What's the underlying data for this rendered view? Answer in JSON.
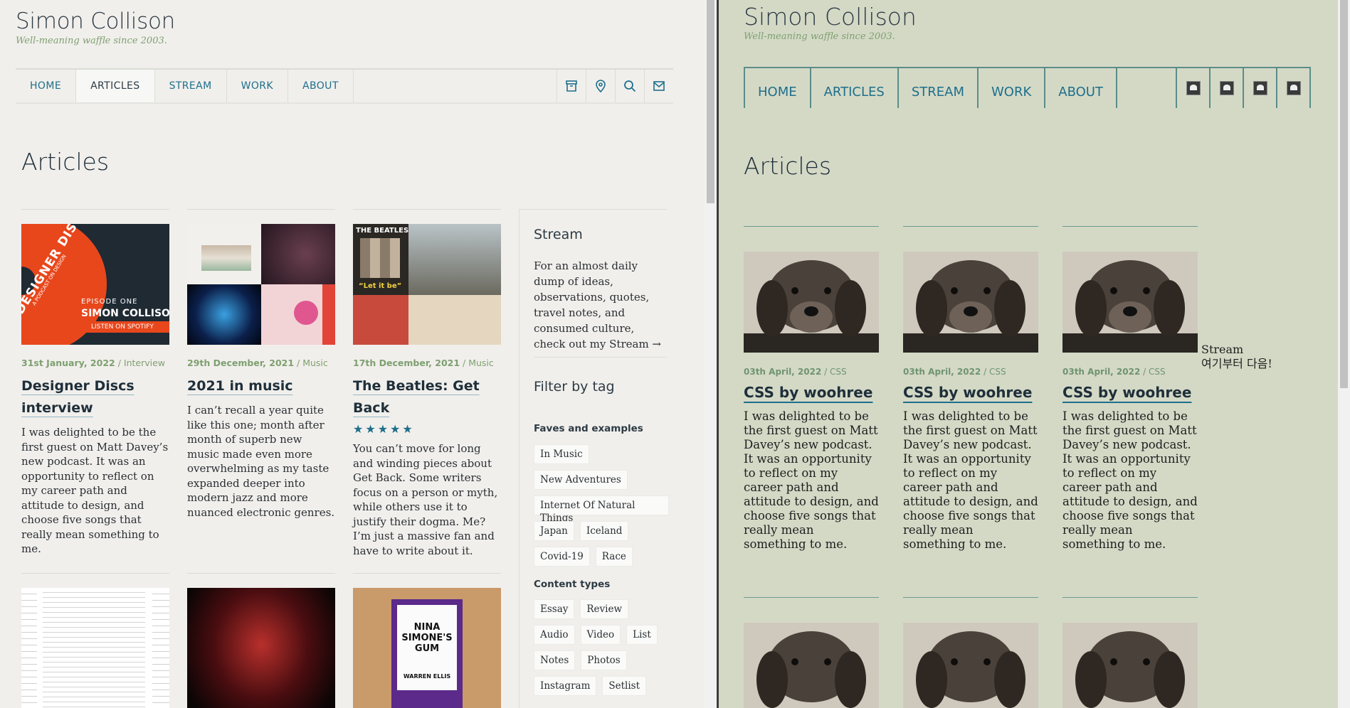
{
  "left": {
    "site_title": "Simon Collison",
    "tagline": "Well-meaning waffle since 2003.",
    "nav": [
      "HOME",
      "ARTICLES",
      "STREAM",
      "WORK",
      "ABOUT"
    ],
    "nav_icons": [
      "archive-icon",
      "location-pin-icon",
      "search-icon",
      "mail-icon"
    ],
    "page_heading": "Articles",
    "articles": [
      {
        "date": "31st January, 2022",
        "category": "Interview",
        "title": "Designer Discs interview",
        "excerpt": "I was delighted to be the first guest on Matt Davey’s new podcast. It was an opportunity to reflect on my career path and attitude to design, and choose five songs that really mean something to me.",
        "thumb_text": {
          "episode": "EPISODE ONE",
          "name": "SIMON COLLISO",
          "cta": "LISTEN ON SPOTIFY",
          "brand": "DESIGNER DISCS",
          "sub": "A PODCAST ON DESIGN"
        }
      },
      {
        "date": "29th December, 2021",
        "category": "Music",
        "title": "2021 in music",
        "excerpt": "I can’t recall a year quite like this one; month after month of superb new music made even more overwhelming as my taste expanded deeper into modern jazz and more nuanced electronic genres."
      },
      {
        "date": "17th December, 2021",
        "category": "Music",
        "title": "The Beatles: Get Back",
        "stars": "★★★★★",
        "excerpt": "You can’t move for long and winding pieces about Get Back. Some writers focus on a person or myth, while others use it to justify their dogma. Me? I’m just a massive fan and have to write about it.",
        "thumb_text": {
          "band": "THE BEATLES",
          "album": "“Let it be”"
        }
      }
    ],
    "second_row_thumb_text": {
      "book_title": "NINA SIMONE'S GUM",
      "book_author": "WARREN ELLIS"
    },
    "aside": {
      "stream_heading": "Stream",
      "stream_text": "For an almost daily dump of ideas, observations, quotes, travel notes, and consumed culture, check out my Stream →",
      "filter_heading": "Filter by tag",
      "faves_heading": "Faves and examples",
      "faves_tags": [
        "In Music",
        "New Adventures",
        "Internet Of Natural Things",
        "Japan",
        "Iceland",
        "Covid-19",
        "Race"
      ],
      "content_heading": "Content types",
      "content_tags": [
        "Essay",
        "Review",
        "Audio",
        "Video",
        "List",
        "Notes",
        "Photos",
        "Instagram",
        "Setlist"
      ]
    }
  },
  "right": {
    "site_title": "Simon Collison",
    "tagline": "Well-meaning waffle since 2003.",
    "nav": [
      "HOME",
      "ARTICLES",
      "STREAM",
      "WORK",
      "ABOUT"
    ],
    "page_heading": "Articles",
    "card": {
      "date": "03th April, 2022",
      "category": "CSS",
      "title": "CSS by woohree",
      "excerpt": "I was delighted to be the first guest on Matt Davey’s new podcast. It was an opportunity to reflect on my career path and attitude to design, and choose five songs that really mean something to me."
    },
    "stream_fallback_line1": "Stream",
    "stream_fallback_line2": "여기부터 다음!"
  },
  "colors": {
    "accent": "#1d6f8b",
    "tag_green": "#7ea070",
    "left_bg": "#f1efec",
    "right_bg": "#d4d9c6",
    "right_rule": "#5b8d89"
  }
}
